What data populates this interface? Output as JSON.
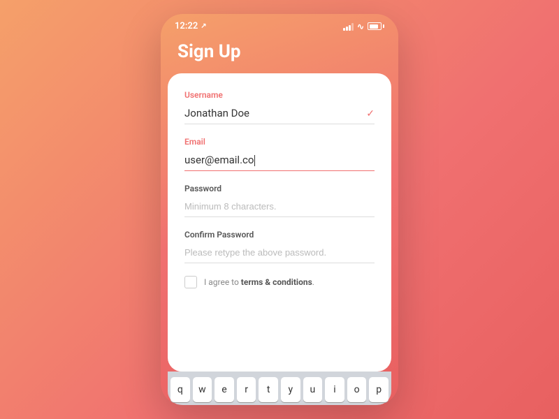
{
  "statusBar": {
    "time": "12:22",
    "locationIcon": "→"
  },
  "pageTitle": "Sign Up",
  "form": {
    "usernameLabel": "Username",
    "usernameValue": "Jonathan Doe",
    "usernameValid": true,
    "emailLabel": "Email",
    "emailValue": "user@email.co",
    "emailActive": true,
    "passwordLabel": "Password",
    "passwordPlaceholder": "Minimum 8 characters.",
    "confirmPasswordLabel": "Confirm Password",
    "confirmPasswordPlaceholder": "Please retype the above password.",
    "termsText": "I agree to ",
    "termsLink": "terms & conditions",
    "termsPeriod": "."
  },
  "keyboard": {
    "keys": [
      "q",
      "w",
      "e",
      "r",
      "t",
      "y",
      "u",
      "i",
      "o",
      "p"
    ]
  }
}
